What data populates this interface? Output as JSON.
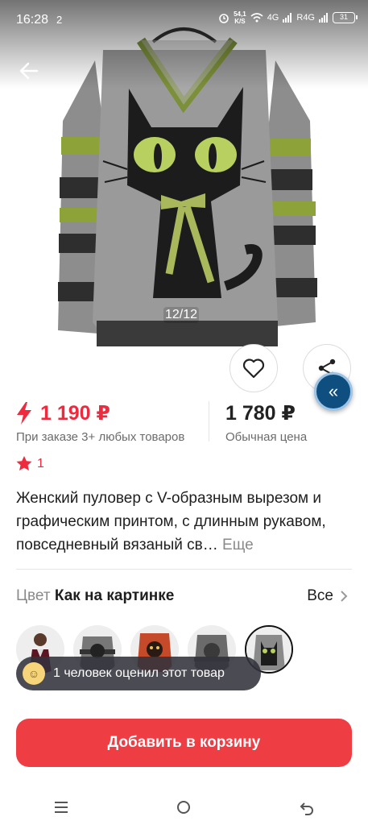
{
  "status_bar": {
    "time": "16:28",
    "notification": "2",
    "speed_value": "54,1",
    "speed_unit": "K/S",
    "network_4g": "4G",
    "network_r4g": "R4G",
    "battery": "31"
  },
  "gallery": {
    "counter": "12/12"
  },
  "pricing": {
    "promo_price": "1 190 ₽",
    "promo_condition": "При заказе 3+ любых товаров",
    "regular_price": "1 780 ₽",
    "regular_label": "Обычная цена"
  },
  "rating": {
    "value": "1"
  },
  "product": {
    "title": "Женский пуловер с V-образным вырезом и графическим принтом, с длинным рукавом, повседневный вязаный св…",
    "more_label": "Еще"
  },
  "color": {
    "label": "Цвет",
    "value": "Как на картинке",
    "all_label": "Все"
  },
  "toast": {
    "text": "1 человек оценил этот товар"
  },
  "cart": {
    "add_label": "Добавить в корзину"
  },
  "colors": {
    "accent": "#ef3d44",
    "price_red": "#ee2a3e",
    "collapse_blue": "#0f4f80"
  },
  "icons": {
    "back": "arrow-left-icon",
    "favorite": "heart-icon",
    "share": "share-icon",
    "collapse": "double-chevron-left-icon",
    "promo": "lightning-icon",
    "star": "star-icon",
    "chevron": "chevron-right-icon"
  }
}
